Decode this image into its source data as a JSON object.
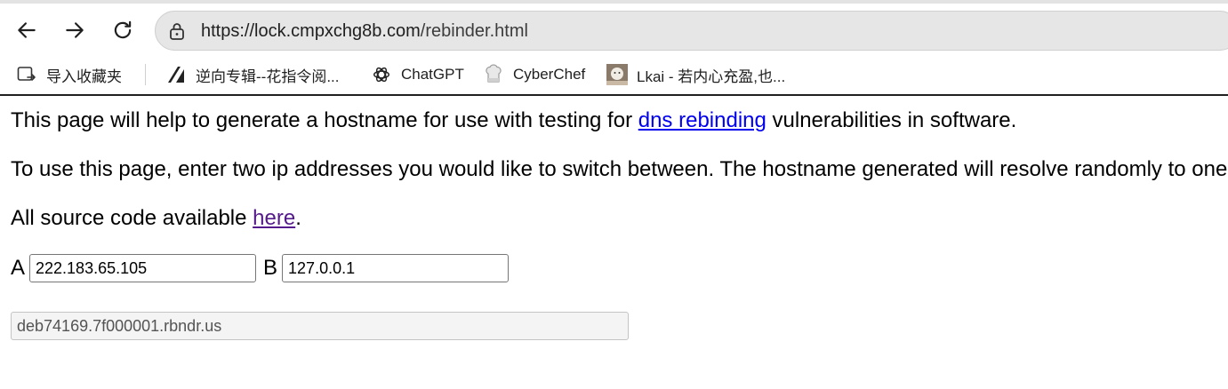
{
  "browser": {
    "url_host": "https://lock.cmpxchg8b.com",
    "url_path": "/rebinder.html"
  },
  "bookmarks": [
    {
      "label": "导入收藏夹",
      "icon": "import-bookmarks-icon"
    },
    {
      "label": "逆向专辑--花指令阅...",
      "icon": "bookmark-favicon-icon"
    },
    {
      "label": "ChatGPT",
      "icon": "chatgpt-icon"
    },
    {
      "label": "CyberChef",
      "icon": "cyberchef-icon"
    },
    {
      "label": "Lkai - 若内心充盈,也...",
      "icon": "avatar-favicon-icon"
    }
  ],
  "page": {
    "intro_before": "This page will help to generate a hostname for use with testing for ",
    "intro_link": "dns rebinding",
    "intro_after": " vulnerabilities in software.",
    "usage": "To use this page, enter two ip addresses you would like to switch between. The hostname generated will resolve randomly to one of the addresses specified with a very low ttl.",
    "source_before": "All source code available ",
    "source_link": "here",
    "source_after": ".",
    "label_a": "A",
    "value_a": "222.183.65.105",
    "label_b": "B",
    "value_b": "127.0.0.1",
    "hostname": "deb74169.7f000001.rbndr.us"
  }
}
